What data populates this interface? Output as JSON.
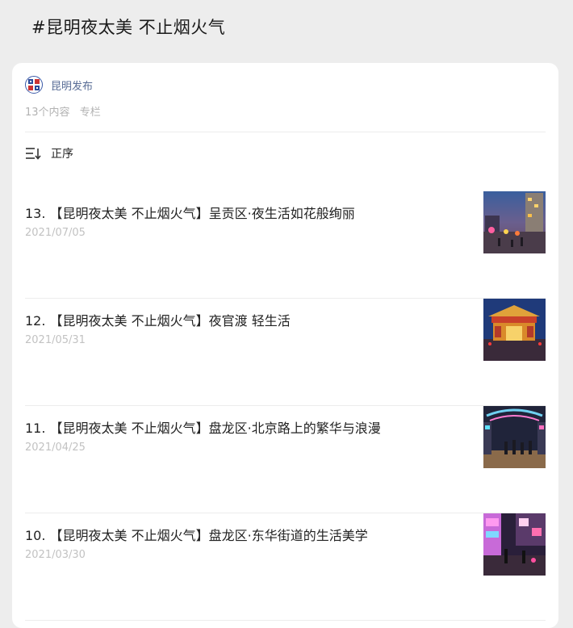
{
  "topic": {
    "title": "#昆明夜太美 不止烟火气"
  },
  "author": {
    "name": "昆明发布",
    "logo_icon": "kunming-fabu-logo-icon"
  },
  "meta": {
    "count": "13个内容",
    "type": "专栏"
  },
  "sort": {
    "label": "正序",
    "icon": "sort-order-icon"
  },
  "articles": [
    {
      "title": "13. 【昆明夜太美 不止烟火气】呈贡区·夜生活如花般绚丽",
      "date": "2021/07/05"
    },
    {
      "title": "12. 【昆明夜太美 不止烟火气】夜官渡 轻生活",
      "date": "2021/05/31"
    },
    {
      "title": "11. 【昆明夜太美 不止烟火气】盘龙区·北京路上的繁华与浪漫",
      "date": "2021/04/25"
    },
    {
      "title": "10. 【昆明夜太美 不止烟火气】盘龙区·东华街道的生活美学",
      "date": "2021/03/30"
    }
  ],
  "colors": {
    "author_link": "#576b95",
    "muted_text": "#b2b2b2",
    "page_bg": "#ededed",
    "card_bg": "#ffffff"
  }
}
